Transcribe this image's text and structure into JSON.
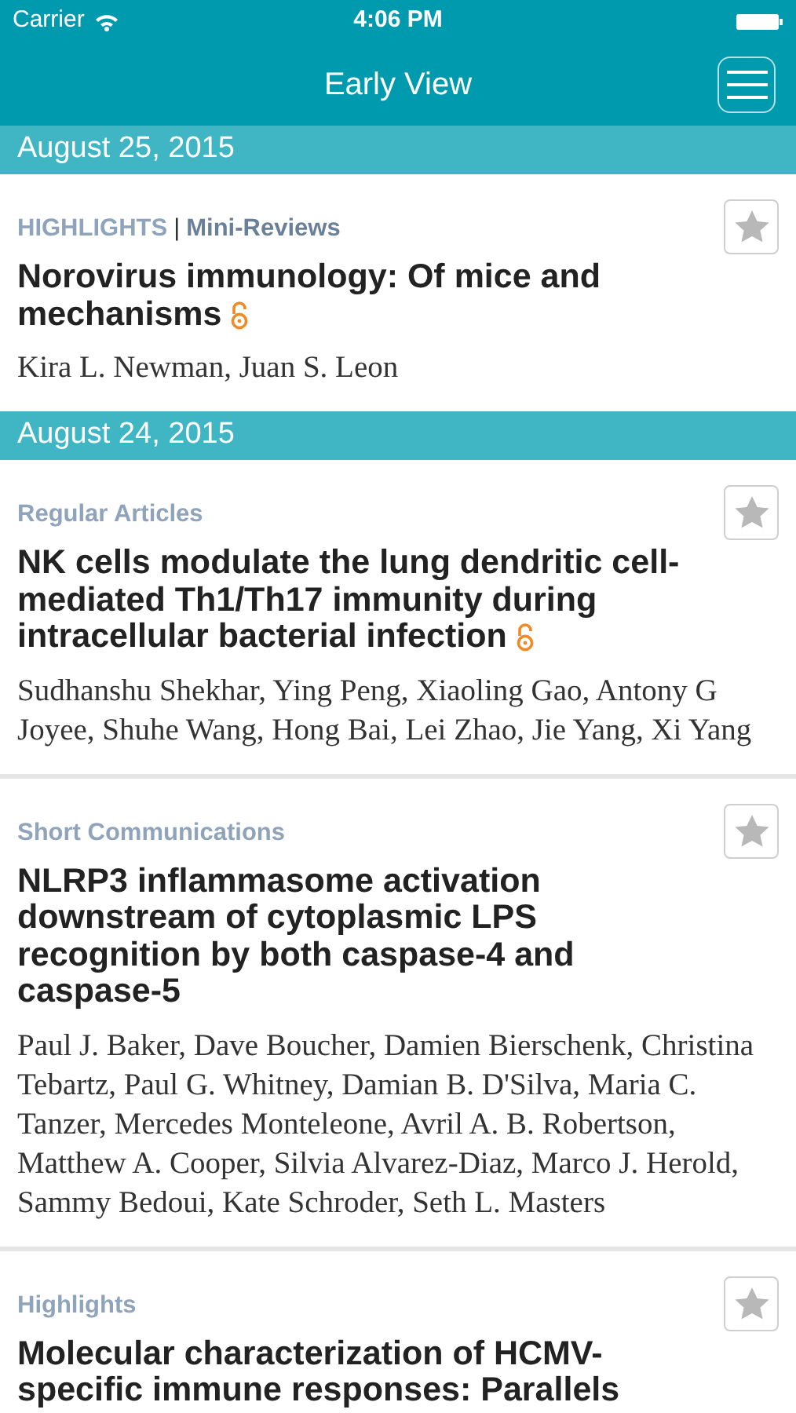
{
  "status_bar": {
    "carrier": "Carrier",
    "time": "4:06 PM"
  },
  "nav_bar": {
    "title": "Early View"
  },
  "sections": [
    {
      "date": "August 25, 2015",
      "articles": [
        {
          "category": [
            {
              "text": "HIGHLIGHTS",
              "kind": "section"
            },
            {
              "text": "|",
              "kind": "separator"
            },
            {
              "text": "Mini-Reviews",
              "kind": "type"
            }
          ],
          "title": "Norovirus immunology: Of mice and mechanisms",
          "open_access": true,
          "authors": "Kira L. Newman, Juan S. Leon",
          "starred": false
        }
      ]
    },
    {
      "date": "August 24, 2015",
      "articles": [
        {
          "category": [
            {
              "text": "Regular Articles",
              "kind": "section"
            }
          ],
          "title": "NK cells modulate the lung dendritic cell-mediated Th1/Th17 immunity during intracellular bacterial infection",
          "open_access": true,
          "authors": "Sudhanshu Shekhar, Ying Peng, Xiaoling Gao, Antony G Joyee, Shuhe Wang, Hong Bai, Lei Zhao, Jie Yang, Xi Yang",
          "starred": false
        },
        {
          "category": [
            {
              "text": "Short Communications",
              "kind": "section"
            }
          ],
          "title": "NLRP3 inflammasome activation downstream of cytoplasmic LPS recognition by both caspase-4 and caspase-5",
          "open_access": false,
          "authors": "Paul J. Baker, Dave Boucher, Damien Bierschenk, Christina Tebartz, Paul G. Whitney, Damian B. D'Silva, Maria C. Tanzer, Mercedes Monteleone, Avril A. B. Robertson, Matthew A. Cooper, Silvia Alvarez-Diaz, Marco J. Herold, Sammy Bedoui, Kate Schroder, Seth L. Masters",
          "starred": false
        },
        {
          "category": [
            {
              "text": "Highlights",
              "kind": "section"
            }
          ],
          "title": "Molecular characterization of HCMV-specific immune responses: Parallels",
          "open_access": false,
          "starred": false
        }
      ]
    }
  ]
}
